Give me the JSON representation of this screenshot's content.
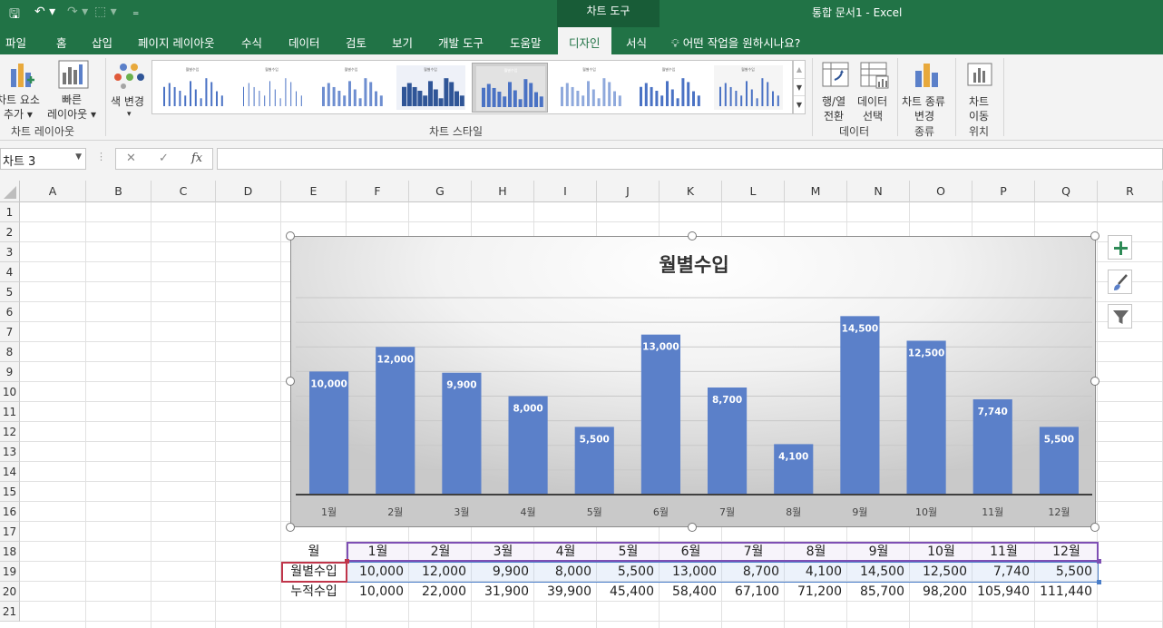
{
  "titlebar": {
    "qa_save": "🖫",
    "qa_undo": "↶ ▾",
    "qa_redo": "↷ ▾",
    "qa_touch": "⬚ ▾",
    "qa_more": "₌",
    "context": "차트 도구",
    "doc_title": "통합 문서1  -  Excel"
  },
  "tabs": [
    {
      "label": "파일"
    },
    {
      "label": "홈"
    },
    {
      "label": "삽입"
    },
    {
      "label": "페이지 레이아웃"
    },
    {
      "label": "수식"
    },
    {
      "label": "데이터"
    },
    {
      "label": "검토"
    },
    {
      "label": "보기"
    },
    {
      "label": "개발 도구"
    },
    {
      "label": "도움말"
    },
    {
      "label": "디자인"
    },
    {
      "label": "서식"
    }
  ],
  "tell_me": "어떤 작업을 원하시나요?",
  "ribbon": {
    "add_element_1": "차트 요소",
    "add_element_2": "추가 ▾",
    "quick_layout_1": "빠른",
    "quick_layout_2": "레이아웃 ▾",
    "group_layout": "차트 레이아웃",
    "change_colors": "색 변경",
    "change_colors_dd": "▾",
    "group_styles": "차트 스타일",
    "thumb_title": "월별수입",
    "switch_row_1": "행/열",
    "switch_row_2": "전환",
    "select_data_1": "데이터",
    "select_data_2": "선택",
    "group_data": "데이터",
    "change_type_1": "차트 종류",
    "change_type_2": "변경",
    "group_type": "종류",
    "move_chart_1": "차트",
    "move_chart_2": "이동",
    "group_location": "위치",
    "gallery_up": "▲",
    "gallery_down": "▼",
    "gallery_more": "▼"
  },
  "formula_bar": {
    "name_box": "차트 3",
    "cancel": "✕",
    "enter": "✓",
    "fx": "fx",
    "formula": ""
  },
  "columns": [
    "A",
    "B",
    "C",
    "D",
    "E",
    "F",
    "G",
    "H",
    "I",
    "J",
    "K",
    "L",
    "M",
    "N",
    "O",
    "P",
    "Q",
    "R"
  ],
  "rows": [
    "1",
    "2",
    "3",
    "4",
    "5",
    "6",
    "7",
    "8",
    "9",
    "10",
    "11",
    "12",
    "13",
    "14",
    "15",
    "16",
    "17",
    "18",
    "19",
    "20",
    "21"
  ],
  "table": {
    "row18": [
      "월",
      "1월",
      "2월",
      "3월",
      "4월",
      "5월",
      "6월",
      "7월",
      "8월",
      "9월",
      "10월",
      "11월",
      "12월"
    ],
    "row19": [
      "월별수입",
      "10,000",
      "12,000",
      "9,900",
      "8,000",
      "5,500",
      "13,000",
      "8,700",
      "4,100",
      "14,500",
      "12,500",
      "7,740",
      "5,500"
    ],
    "row20": [
      "누적수입",
      "10,000",
      "22,000",
      "31,900",
      "39,900",
      "45,400",
      "58,400",
      "67,100",
      "71,200",
      "85,700",
      "98,200",
      "105,940",
      "111,440"
    ]
  },
  "chart_data": {
    "type": "bar",
    "title": "월별수입",
    "categories": [
      "1월",
      "2월",
      "3월",
      "4월",
      "5월",
      "6월",
      "7월",
      "8월",
      "9월",
      "10월",
      "11월",
      "12월"
    ],
    "series": [
      {
        "values": [
          10000,
          12000,
          9900,
          8000,
          5500,
          13000,
          8700,
          4100,
          14500,
          12500,
          7740,
          5500
        ]
      }
    ],
    "data_labels": [
      "10,000",
      "12,000",
      "9,900",
      "8,000",
      "5,500",
      "13,000",
      "8,700",
      "4,100",
      "14,500",
      "12,500",
      "7,740",
      "5,500"
    ],
    "ylim": [
      0,
      16000
    ],
    "grid": true,
    "bar_color": "#5b80c9",
    "xlabel": "",
    "ylabel": ""
  },
  "colors": {
    "excel_green": "#217346",
    "context_green": "#185c37",
    "bar": "#5b80c9"
  }
}
